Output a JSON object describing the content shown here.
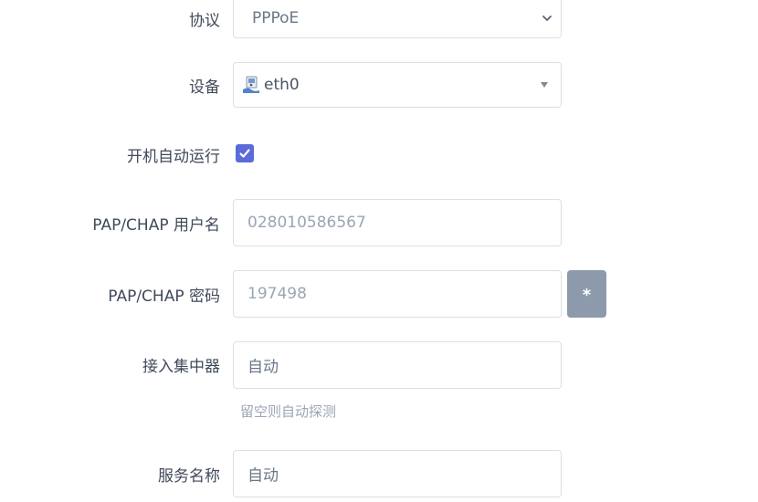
{
  "form": {
    "protocol": {
      "label": "协议",
      "value": "PPPoE"
    },
    "device": {
      "label": "设备",
      "value": "eth0",
      "icon": "network-device-icon"
    },
    "autostart": {
      "label": "开机自动运行",
      "checked": true
    },
    "username": {
      "label": "PAP/CHAP 用户名",
      "value": "028010586567"
    },
    "password": {
      "label": "PAP/CHAP 密码",
      "value": "197498",
      "reveal_label": "*"
    },
    "concentrator": {
      "label": "接入集中器",
      "placeholder": "自动",
      "hint": "留空则自动探测"
    },
    "service_name": {
      "label": "服务名称",
      "placeholder": "自动"
    }
  },
  "colors": {
    "accent": "#5b6bd9",
    "reveal_button": "#8d9aac",
    "border": "#dcdfe6"
  }
}
